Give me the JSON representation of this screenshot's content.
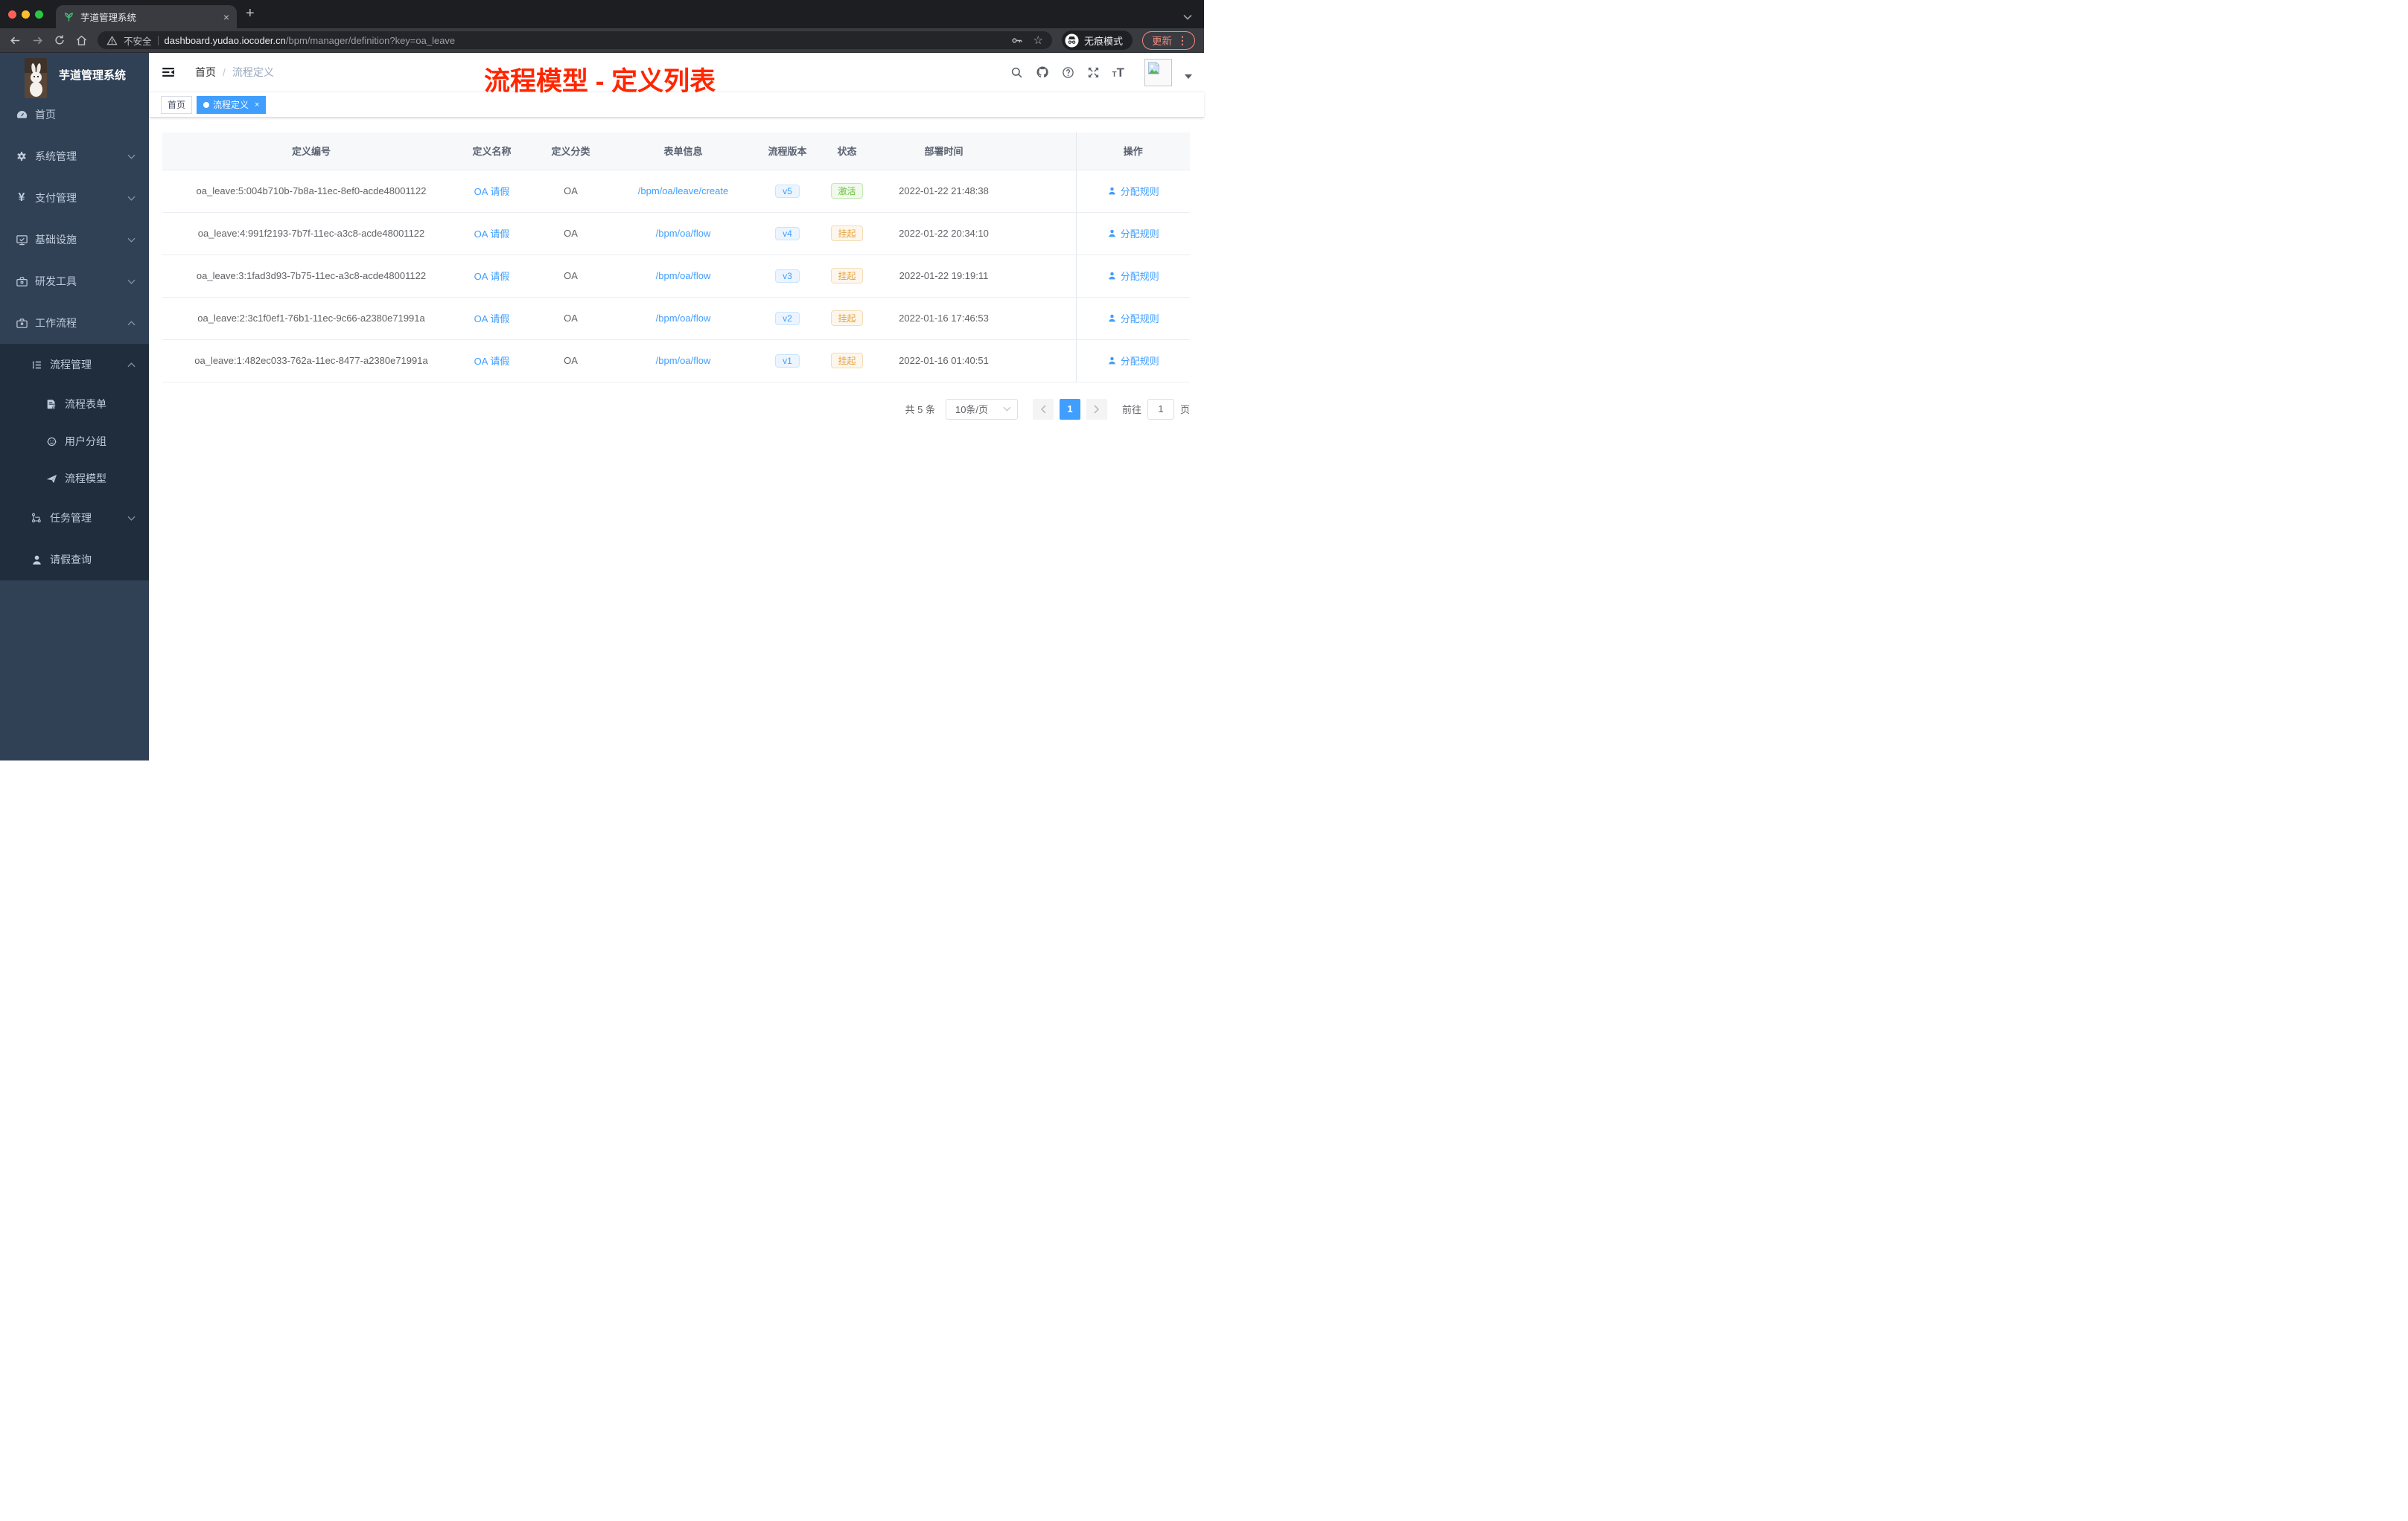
{
  "theme": {
    "primary": "#409eff",
    "success": "#67c23a",
    "warning": "#e6a23c",
    "annotation": "#ff2600",
    "sidebar_bg": "#304156",
    "sidebar_submenu_bg": "#1f2d3d"
  },
  "browser": {
    "tab_title": "芋道管理系统",
    "close_glyph": "×",
    "new_tab_glyph": "+",
    "security_label": "不安全",
    "url_host": "dashboard.yudao.iocoder.cn",
    "url_path": "/bpm/manager/definition?key=oa_leave",
    "incognito_label": "无痕模式",
    "update_label": "更新",
    "menu_glyph": "⋮",
    "star_glyph": "☆"
  },
  "sidebar": {
    "app_title": "芋道管理系统",
    "items": [
      {
        "label": "首页",
        "icon": "dashboard-icon"
      },
      {
        "label": "系统管理",
        "icon": "gear-icon",
        "chevron": "down"
      },
      {
        "label": "支付管理",
        "icon": "yen-icon",
        "icon_glyph": "¥",
        "chevron": "down"
      },
      {
        "label": "基础设施",
        "icon": "monitor-icon",
        "chevron": "down"
      },
      {
        "label": "研发工具",
        "icon": "toolbox-icon",
        "chevron": "down"
      },
      {
        "label": "工作流程",
        "icon": "briefcase-icon",
        "chevron": "up"
      },
      {
        "label": "流程管理",
        "icon": "list-tree-icon",
        "chevron": "up"
      },
      {
        "label": "流程表单",
        "icon": "form-icon"
      },
      {
        "label": "用户分组",
        "icon": "user-group-icon"
      },
      {
        "label": "流程模型",
        "icon": "paper-plane-icon"
      },
      {
        "label": "任务管理",
        "icon": "flow-icon",
        "chevron": "down"
      },
      {
        "label": "请假查询",
        "icon": "user-icon"
      }
    ]
  },
  "navbar": {
    "breadcrumb_home": "首页",
    "breadcrumb_sep": "/",
    "breadcrumb_current": "流程定义",
    "annotation": "流程模型 - 定义列表"
  },
  "tags": [
    {
      "label": "首页",
      "active": false
    },
    {
      "label": "流程定义",
      "active": true,
      "close_glyph": "×"
    }
  ],
  "table": {
    "columns": [
      "定义编号",
      "定义名称",
      "定义分类",
      "表单信息",
      "流程版本",
      "状态",
      "部署时间",
      "操作"
    ],
    "action_label": "分配规则",
    "rows": [
      {
        "id": "oa_leave:5:004b710b-7b8a-11ec-8ef0-acde48001122",
        "name": "OA 请假",
        "category": "OA",
        "form": "/bpm/oa/leave/create",
        "version": "v5",
        "status": "激活",
        "status_type": "active",
        "deploy_time": "2022-01-22 21:48:38"
      },
      {
        "id": "oa_leave:4:991f2193-7b7f-11ec-a3c8-acde48001122",
        "name": "OA 请假",
        "category": "OA",
        "form": "/bpm/oa/flow",
        "version": "v4",
        "status": "挂起",
        "status_type": "suspended",
        "deploy_time": "2022-01-22 20:34:10"
      },
      {
        "id": "oa_leave:3:1fad3d93-7b75-11ec-a3c8-acde48001122",
        "name": "OA 请假",
        "category": "OA",
        "form": "/bpm/oa/flow",
        "version": "v3",
        "status": "挂起",
        "status_type": "suspended",
        "deploy_time": "2022-01-22 19:19:11"
      },
      {
        "id": "oa_leave:2:3c1f0ef1-76b1-11ec-9c66-a2380e71991a",
        "name": "OA 请假",
        "category": "OA",
        "form": "/bpm/oa/flow",
        "version": "v2",
        "status": "挂起",
        "status_type": "suspended",
        "deploy_time": "2022-01-16 17:46:53"
      },
      {
        "id": "oa_leave:1:482ec033-762a-11ec-8477-a2380e71991a",
        "name": "OA 请假",
        "category": "OA",
        "form": "/bpm/oa/flow",
        "version": "v1",
        "status": "挂起",
        "status_type": "suspended",
        "deploy_time": "2022-01-16 01:40:51"
      }
    ]
  },
  "pagination": {
    "total_label": "共 5 条",
    "page_size_label": "10条/页",
    "current_page": "1",
    "goto_label": "前往",
    "goto_value": "1",
    "page_unit_label": "页"
  }
}
